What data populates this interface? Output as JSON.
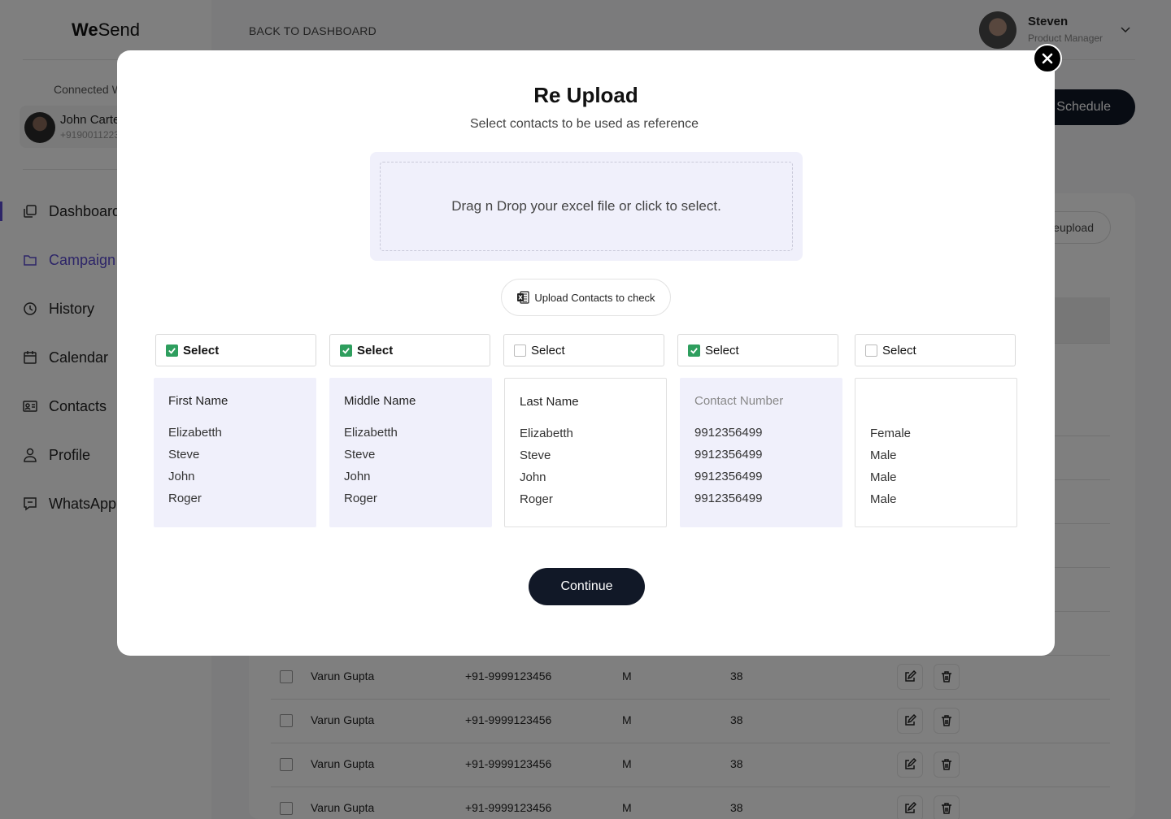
{
  "app": {
    "brand_bold": "We",
    "brand_rest": "Send"
  },
  "sidebar": {
    "connected_label": "Connected W",
    "account_name": "John Carte",
    "account_phone": "+9190011223",
    "items": [
      {
        "label": "Dashboard",
        "icon": "dashboard-icon"
      },
      {
        "label": "Campaign",
        "icon": "folder-icon"
      },
      {
        "label": "History",
        "icon": "clock-icon"
      },
      {
        "label": "Calendar",
        "icon": "calendar-icon"
      },
      {
        "label": "Contacts",
        "icon": "contacts-icon"
      },
      {
        "label": "Profile",
        "icon": "user-icon"
      },
      {
        "label": "WhatsApp",
        "icon": "chat-icon"
      }
    ],
    "active_color": "#5b4bd1"
  },
  "header": {
    "back_label": "BACK TO DASHBOARD",
    "user_name": "Steven",
    "user_role": "Product Manager"
  },
  "toolbar": {
    "schedule_label": "Schedule",
    "reupload_label": "eupload"
  },
  "table": {
    "rows": [
      {
        "name": "Varun Gupta",
        "phone": "+91-9999123456",
        "gender": "M",
        "age": "38"
      },
      {
        "name": "Varun Gupta",
        "phone": "+91-9999123456",
        "gender": "M",
        "age": "38"
      },
      {
        "name": "Varun Gupta",
        "phone": "+91-9999123456",
        "gender": "M",
        "age": "38"
      },
      {
        "name": "Varun Gupta",
        "phone": "+91-9999123456",
        "gender": "M",
        "age": "38"
      }
    ]
  },
  "modal": {
    "title": "Re Upload",
    "subtitle": "Select contacts to be used as reference",
    "dropzone_text": "Drag n Drop your excel file or click to select.",
    "upload_button": "Upload Contacts to check",
    "continue_button": "Continue",
    "columns": [
      {
        "select_label": "Select",
        "checked": true,
        "header": "First Name",
        "values": [
          "Elizabetth",
          "Steve",
          "John",
          "Roger"
        ]
      },
      {
        "select_label": "Select",
        "checked": true,
        "header": "Middle Name",
        "values": [
          "Elizabetth",
          "Steve",
          "John",
          "Roger"
        ]
      },
      {
        "select_label": "Select",
        "checked": false,
        "header": "Last Name",
        "values": [
          "Elizabetth",
          "Steve",
          "John",
          "Roger"
        ]
      },
      {
        "select_label": "Select",
        "checked": true,
        "header": "Contact Number",
        "values": [
          "9912356499",
          "9912356499",
          "9912356499",
          "9912356499"
        ]
      },
      {
        "select_label": "Select",
        "checked": false,
        "header": "",
        "values": [
          "Female",
          "Male",
          "Male",
          "Male"
        ]
      }
    ],
    "check_color": "#2e9e5e",
    "tint_color": "#f0f0fb"
  }
}
